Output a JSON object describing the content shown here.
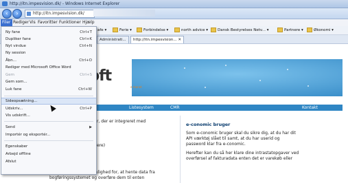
{
  "window": {
    "title": "http://itn.impesvision.dk/ - Windows Internet Explorer"
  },
  "address": {
    "url": "http://itn.impesvision.dk/"
  },
  "menubar": [
    {
      "label": "Filer"
    },
    {
      "label": "Rediger"
    },
    {
      "label": "Vis"
    },
    {
      "label": "Favoritter"
    },
    {
      "label": "Funktioner"
    },
    {
      "label": "Hjælp"
    }
  ],
  "favorites": [
    "afe",
    "Ferie",
    "Forbindelse",
    "north advice",
    "Dansk Bestyrelses Netv...",
    "Partnere",
    "Økonomi"
  ],
  "tabs": [
    "Administrati...",
    "http://itn.impesvision..."
  ],
  "file_menu": {
    "items": [
      {
        "label": "Ny fane",
        "shortcut": "Ctrl+T"
      },
      {
        "label": "Dupliker fane",
        "shortcut": "Ctrl+K"
      },
      {
        "label": "Nyt vindue",
        "shortcut": "Ctrl+N"
      },
      {
        "label": "Ny session",
        "shortcut": ""
      },
      {
        "label": "Åbn...",
        "shortcut": "Ctrl+O"
      },
      {
        "label": "Rediger med Microsoft Office Word",
        "shortcut": ""
      },
      {
        "label": "Gem",
        "shortcut": "Ctrl+S"
      },
      {
        "label": "Gem som...",
        "shortcut": ""
      },
      {
        "label": "Luk fane",
        "shortcut": "Ctrl+W"
      },
      {
        "label": "Sideopsætning...",
        "shortcut": ""
      },
      {
        "label": "Udskriv...",
        "shortcut": "Ctrl+P"
      },
      {
        "label": "Vis udskrift...",
        "shortcut": ""
      },
      {
        "label": "Send",
        "shortcut": ""
      },
      {
        "label": "Importér og eksportér...",
        "shortcut": ""
      },
      {
        "label": "Egenskaber",
        "shortcut": ""
      },
      {
        "label": "Arbejd offline",
        "shortcut": ""
      },
      {
        "label": "Afslut",
        "shortcut": ""
      }
    ]
  },
  "page": {
    "logo": "oft",
    "logo_sub": "e manet",
    "nav_links": [
      "Listesystem",
      "CMR",
      "Kontakt"
    ],
    "left_text": [
      "r, der er integreret med",
      "ere)",
      "Løsningen giver dig mulighed for, at hente data fra",
      "bogføringssystemet og overføre dem til enten"
    ],
    "right_heading": "e-conomic bruger",
    "right_text": [
      "Som e-conomic bruger skal du sikre dig, at du har dit",
      "API værktøj slået til samt, at du har userid og",
      "password klar fra e-conomic.",
      "Herefter kan du så her klare dine intrastatopgaver ved",
      "overførsel af fakturadata enten det er varekøb eller"
    ]
  }
}
